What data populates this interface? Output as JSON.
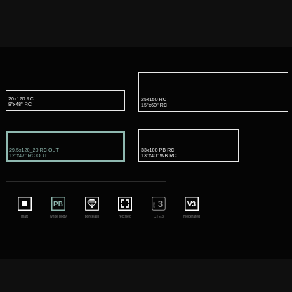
{
  "tiles": [
    {
      "line1": "20x120 RC",
      "line2": "8\"x48\" RC"
    },
    {
      "line1": "25x150 RC",
      "line2": "15\"x60\" RC"
    },
    {
      "line1": "29,5x120_20 RC OUT",
      "line2": "12\"x47\" RC OUT"
    },
    {
      "line1": "33x100 PB RC",
      "line2": "13\"x40\" WB RC"
    }
  ],
  "features": [
    {
      "icon": "matt-square-icon",
      "caption": "matt"
    },
    {
      "icon": "pb-badge-icon",
      "badge": "PB",
      "caption": "white body"
    },
    {
      "icon": "porcelain-diamond-icon",
      "caption": "porcelain"
    },
    {
      "icon": "rectified-corners-icon",
      "caption": "rectified"
    },
    {
      "icon": "cte3-icon",
      "badge_small": "CTE",
      "badge_big": "3",
      "caption": "CTE 3"
    },
    {
      "icon": "v3-badge-icon",
      "badge": "V3",
      "caption": "moderated"
    }
  ],
  "colors": {
    "background": "#0f0f0f",
    "band": "#050505",
    "tile_border": "#e8e8e8",
    "selected": "#8fb9b0",
    "caption": "#7d7d7d"
  }
}
